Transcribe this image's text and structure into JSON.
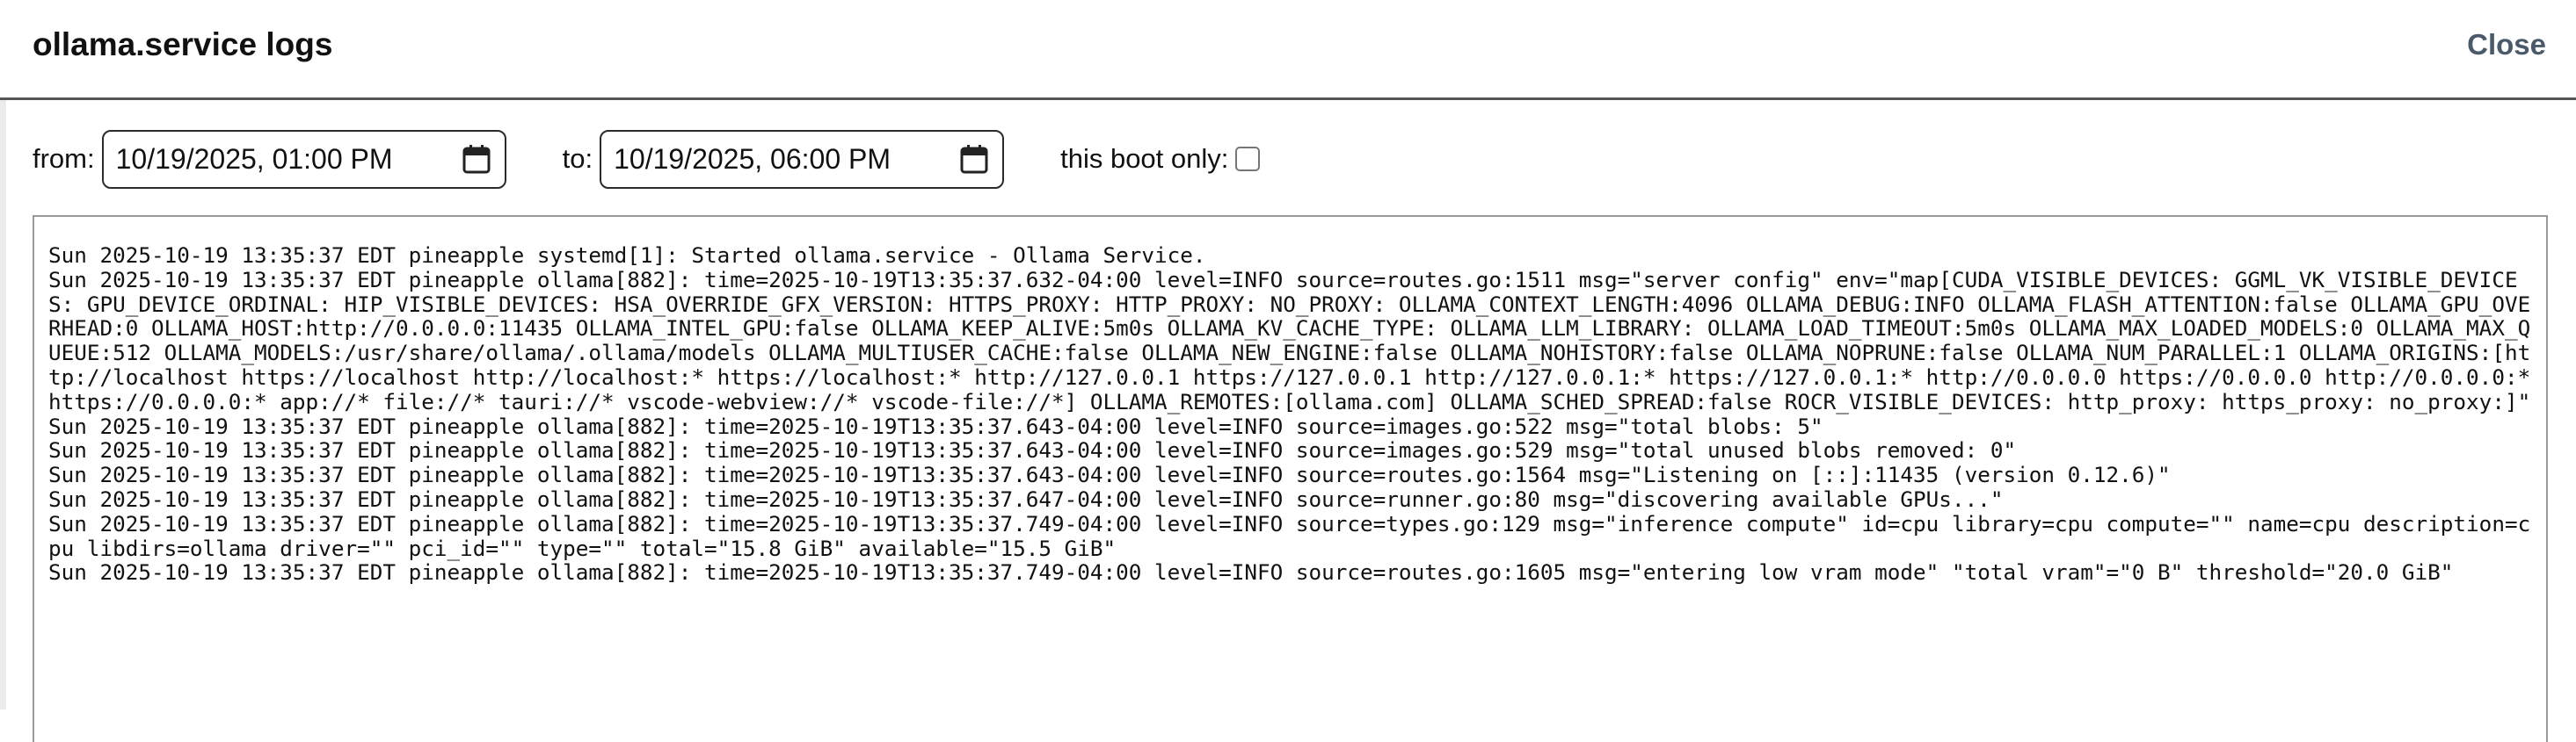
{
  "dialog": {
    "title": "ollama.service logs",
    "close_label": "Close"
  },
  "filters": {
    "from_label": "from:",
    "from_value": "10/19/2025, 01:00  PM",
    "to_label": "to:",
    "to_value": "10/19/2025, 06:00  PM",
    "boot_label": "this boot only:",
    "boot_checked": false
  },
  "logs": {
    "text": "Sun 2025-10-19 13:35:37 EDT pineapple systemd[1]: Started ollama.service - Ollama Service.\nSun 2025-10-19 13:35:37 EDT pineapple ollama[882]: time=2025-10-19T13:35:37.632-04:00 level=INFO source=routes.go:1511 msg=\"server config\" env=\"map[CUDA_VISIBLE_DEVICES: GGML_VK_VISIBLE_DEVICES: GPU_DEVICE_ORDINAL: HIP_VISIBLE_DEVICES: HSA_OVERRIDE_GFX_VERSION: HTTPS_PROXY: HTTP_PROXY: NO_PROXY: OLLAMA_CONTEXT_LENGTH:4096 OLLAMA_DEBUG:INFO OLLAMA_FLASH_ATTENTION:false OLLAMA_GPU_OVERHEAD:0 OLLAMA_HOST:http://0.0.0.0:11435 OLLAMA_INTEL_GPU:false OLLAMA_KEEP_ALIVE:5m0s OLLAMA_KV_CACHE_TYPE: OLLAMA_LLM_LIBRARY: OLLAMA_LOAD_TIMEOUT:5m0s OLLAMA_MAX_LOADED_MODELS:0 OLLAMA_MAX_QUEUE:512 OLLAMA_MODELS:/usr/share/ollama/.ollama/models OLLAMA_MULTIUSER_CACHE:false OLLAMA_NEW_ENGINE:false OLLAMA_NOHISTORY:false OLLAMA_NOPRUNE:false OLLAMA_NUM_PARALLEL:1 OLLAMA_ORIGINS:[http://localhost https://localhost http://localhost:* https://localhost:* http://127.0.0.1 https://127.0.0.1 http://127.0.0.1:* https://127.0.0.1:* http://0.0.0.0 https://0.0.0.0 http://0.0.0.0:* https://0.0.0.0:* app://* file://* tauri://* vscode-webview://* vscode-file://*] OLLAMA_REMOTES:[ollama.com] OLLAMA_SCHED_SPREAD:false ROCR_VISIBLE_DEVICES: http_proxy: https_proxy: no_proxy:]\"\nSun 2025-10-19 13:35:37 EDT pineapple ollama[882]: time=2025-10-19T13:35:37.643-04:00 level=INFO source=images.go:522 msg=\"total blobs: 5\"\nSun 2025-10-19 13:35:37 EDT pineapple ollama[882]: time=2025-10-19T13:35:37.643-04:00 level=INFO source=images.go:529 msg=\"total unused blobs removed: 0\"\nSun 2025-10-19 13:35:37 EDT pineapple ollama[882]: time=2025-10-19T13:35:37.643-04:00 level=INFO source=routes.go:1564 msg=\"Listening on [::]:11435 (version 0.12.6)\"\nSun 2025-10-19 13:35:37 EDT pineapple ollama[882]: time=2025-10-19T13:35:37.647-04:00 level=INFO source=runner.go:80 msg=\"discovering available GPUs...\"\nSun 2025-10-19 13:35:37 EDT pineapple ollama[882]: time=2025-10-19T13:35:37.749-04:00 level=INFO source=types.go:129 msg=\"inference compute\" id=cpu library=cpu compute=\"\" name=cpu description=cpu libdirs=ollama driver=\"\" pci_id=\"\" type=\"\" total=\"15.8 GiB\" available=\"15.5 GiB\"\nSun 2025-10-19 13:35:37 EDT pineapple ollama[882]: time=2025-10-19T13:35:37.749-04:00 level=INFO source=routes.go:1605 msg=\"entering low vram mode\" \"total vram\"=\"0 B\" threshold=\"20.0 GiB\""
  },
  "icons": {
    "calendar": "calendar-icon"
  }
}
